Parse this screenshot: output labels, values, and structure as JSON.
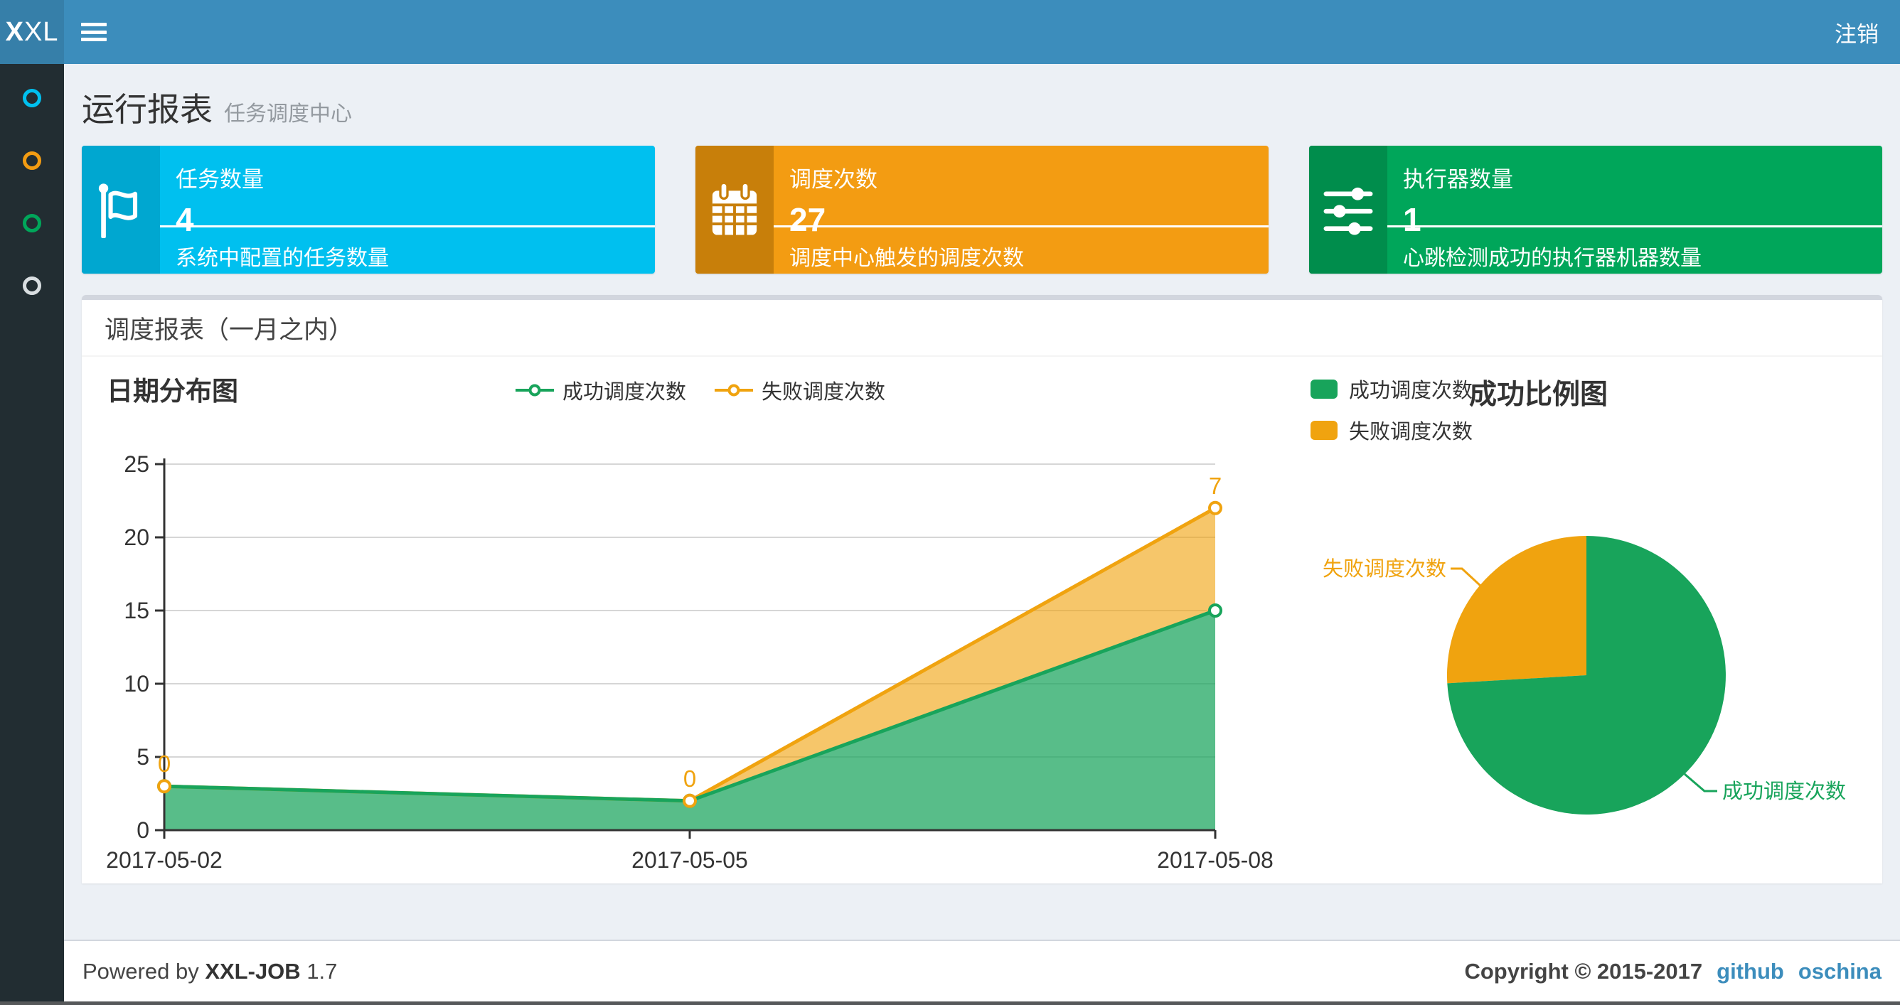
{
  "navbar": {
    "logo_bold": "X",
    "logo_rest": "XL",
    "logout_label": "注销"
  },
  "sidebar": {
    "items": [
      {
        "name": "menu-run-report",
        "color": "#00c0ef"
      },
      {
        "name": "menu-job-manage",
        "color": "#f39c12"
      },
      {
        "name": "menu-job-log",
        "color": "#00a65a"
      },
      {
        "name": "menu-help",
        "color": "#d9dee1"
      }
    ]
  },
  "page": {
    "title": "运行报表",
    "subtitle": "任务调度中心"
  },
  "stat_boxes": [
    {
      "label": "任务数量",
      "value": "4",
      "description": "系统中配置的任务数量",
      "icon": "flag-icon",
      "bg": "#00c0ef",
      "icon_bg": "#00a7d0"
    },
    {
      "label": "调度次数",
      "value": "27",
      "description": "调度中心触发的调度次数",
      "icon": "calendar-icon",
      "bg": "#f39c12",
      "icon_bg": "#c87f0a"
    },
    {
      "label": "执行器数量",
      "value": "1",
      "description": "心跳检测成功的执行器机器数量",
      "icon": "sliders-icon",
      "bg": "#00a65a",
      "icon_bg": "#008d4c"
    }
  ],
  "panel": {
    "title": "调度报表（一月之内）"
  },
  "chart_data": [
    {
      "type": "area",
      "title": "日期分布图",
      "stacked": true,
      "categories": [
        "2017-05-02",
        "2017-05-05",
        "2017-05-08"
      ],
      "series": [
        {
          "name": "成功调度次数",
          "color": "#18a45b",
          "fill_opacity": 0.72,
          "values": [
            3,
            2,
            15
          ]
        },
        {
          "name": "失败调度次数",
          "color": "#f0a30f",
          "fill_opacity": 0.62,
          "values": [
            0,
            0,
            7
          ],
          "data_labels": [
            "0",
            "0",
            "7"
          ]
        }
      ],
      "xlabel": "",
      "ylabel": "",
      "ylim": [
        0,
        25
      ],
      "yticks": [
        0,
        5,
        10,
        15,
        20,
        25
      ],
      "grid": true,
      "legend_position": "top-center"
    },
    {
      "type": "pie",
      "title": "成功比例图",
      "slices": [
        {
          "name": "成功调度次数",
          "value": 20,
          "color": "#18a45b"
        },
        {
          "name": "失败调度次数",
          "value": 7,
          "color": "#f0a30f"
        }
      ],
      "legend_position": "top-left"
    }
  ],
  "footer": {
    "powered_prefix": "Powered by ",
    "product": "XXL-JOB",
    "version": "1.7",
    "copyright": "Copyright © 2015-2017",
    "links": [
      "github",
      "oschina"
    ]
  }
}
